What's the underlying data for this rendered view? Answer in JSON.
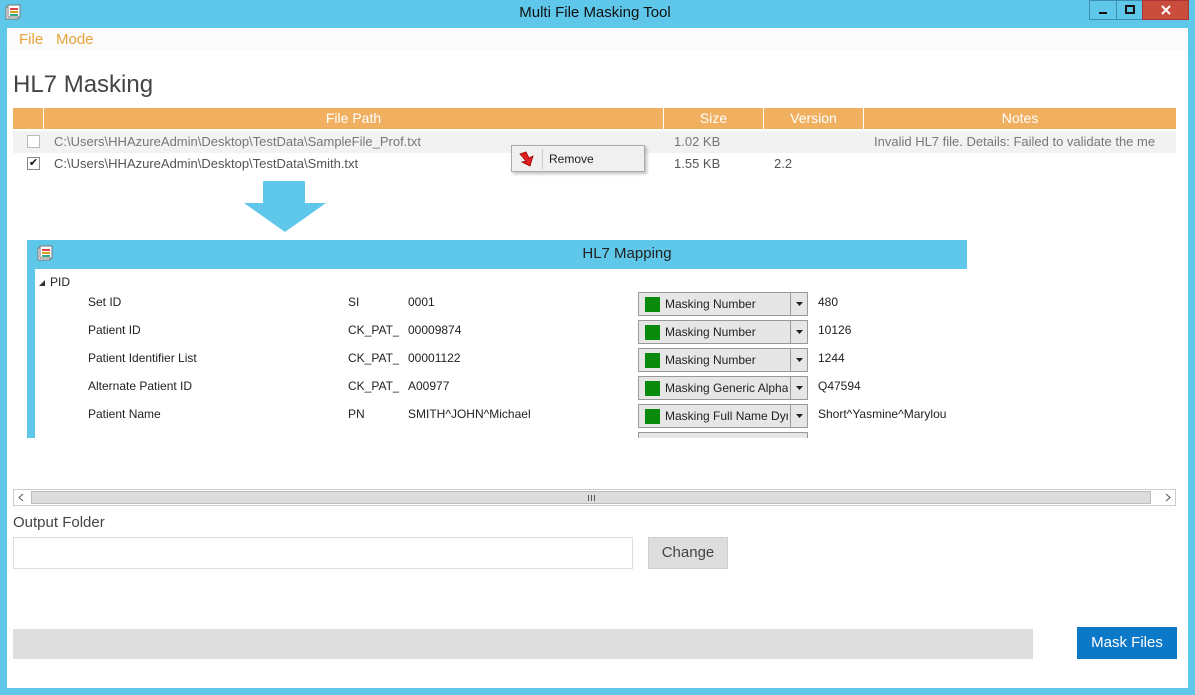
{
  "window": {
    "title": "Multi File Masking Tool"
  },
  "menu": {
    "items": [
      "File",
      "Mode"
    ]
  },
  "page": {
    "title": "HL7 Masking"
  },
  "file_grid": {
    "columns": [
      "File Path",
      "Size",
      "Version",
      "Notes"
    ],
    "rows": [
      {
        "checked": false,
        "path": "C:\\Users\\HHAzureAdmin\\Desktop\\TestData\\SampleFile_Prof.txt",
        "size": "1.02 KB",
        "version": "",
        "notes": "Invalid HL7 file. Details: Failed to validate the me"
      },
      {
        "checked": true,
        "path": "C:\\Users\\HHAzureAdmin\\Desktop\\TestData\\Smith.txt",
        "size": "1.55 KB",
        "version": "2.2",
        "notes": ""
      }
    ]
  },
  "context_menu": {
    "remove_label": "Remove"
  },
  "mapping": {
    "title": "HL7 Mapping",
    "segment": "PID",
    "fields": [
      {
        "name": "Set ID",
        "type": "SI",
        "value": "0001",
        "masking": "Masking Number",
        "masked": "480"
      },
      {
        "name": "Patient ID",
        "type": "CK_PAT_ID",
        "value": "00009874",
        "masking": "Masking Number",
        "masked": "10126"
      },
      {
        "name": "Patient Identifier List",
        "type": "CK_PAT_ID",
        "value": "00001122",
        "masking": "Masking Number",
        "masked": "1244"
      },
      {
        "name": "Alternate Patient ID",
        "type": "CK_PAT_ID",
        "value": "A00977",
        "masking": "Masking Generic Alphanumeric",
        "masked": "Q47594"
      },
      {
        "name": "Patient Name",
        "type": "PN",
        "value": "SMITH^JOHN^Michael",
        "masking": "Masking Full Name Dynamic",
        "masked": "Short^Yasmine^Marylou"
      }
    ]
  },
  "output": {
    "label": "Output Folder",
    "value": "",
    "change_label": "Change"
  },
  "actions": {
    "mask_label": "Mask Files"
  },
  "colors": {
    "titlebar": "#5ec7ea",
    "header": "#f0b060",
    "menu_text": "#e8a33a",
    "mask_button": "#0b78c8",
    "swatch": "#0a8a0a"
  }
}
